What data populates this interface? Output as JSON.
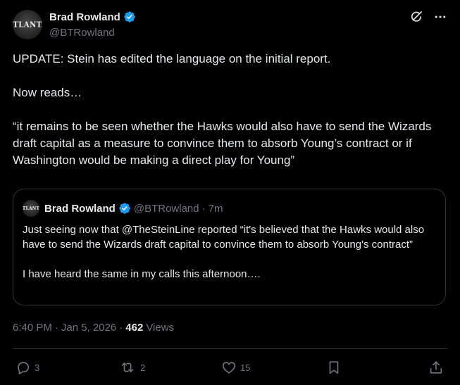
{
  "author": {
    "display_name": "Brad Rowland",
    "handle": "@BTRowland",
    "avatar_text": "ATLANTA",
    "verified_icon": "verified-badge-icon",
    "verified_color": "#1d9bf0"
  },
  "tweet": {
    "paragraphs": [
      "UPDATE: Stein has edited the language on the initial report.",
      "Now reads…",
      "“it remains to be seen whether the Hawks would also have to send the Wizards draft capital as a measure to convince them to absorb Young’s contract or if Washington would be making a direct play for Young”"
    ]
  },
  "quoted_tweet": {
    "display_name": "Brad Rowland",
    "handle": "@BTRowland",
    "separator": "·",
    "time": "7m",
    "avatar_text": "ATLANTA",
    "paragraphs": [
      "Just seeing now that @TheSteinLine reported “it's believed that the Hawks would also have to send the Wizards draft capital to convince them to absorb Young's contract”",
      "I have heard the same in my calls this afternoon…."
    ]
  },
  "meta": {
    "time": "6:40 PM",
    "separator": "·",
    "date": "Jan 5, 2026",
    "separator2": "·",
    "views_count": "462",
    "views_label": "Views"
  },
  "actions": {
    "replies": "3",
    "reposts": "2",
    "likes": "15"
  },
  "icons": {
    "top_right": [
      "grok-icon",
      "more-icon"
    ],
    "actions": [
      "reply-icon",
      "repost-icon",
      "like-icon",
      "bookmark-icon",
      "share-icon"
    ]
  },
  "colors": {
    "background": "#000000",
    "text": "#e7e9ea",
    "secondary": "#71767b",
    "border": "#2f3336",
    "accent": "#1d9bf0"
  }
}
